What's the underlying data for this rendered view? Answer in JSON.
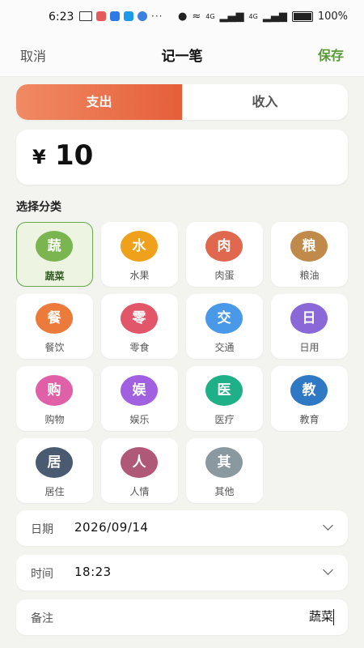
{
  "status": {
    "time": "6:23",
    "dots": "···",
    "network": "4G",
    "network2": "4G",
    "battery": "100%"
  },
  "nav": {
    "cancel": "取消",
    "title": "记一笔",
    "save": "保存"
  },
  "type_toggle": {
    "expense": "支出",
    "income": "收入",
    "selected": "支出"
  },
  "amount": {
    "currency": "¥",
    "value": "10"
  },
  "category_label": "选择分类",
  "categories": [
    {
      "char": "蔬",
      "name": "蔬菜",
      "color": "#7ab54f",
      "selected": true
    },
    {
      "char": "水",
      "name": "水果",
      "color": "#f0a11c"
    },
    {
      "char": "肉",
      "name": "肉蛋",
      "color": "#e0684e"
    },
    {
      "char": "粮",
      "name": "粮油",
      "color": "#c08a4a"
    },
    {
      "char": "餐",
      "name": "餐饮",
      "color": "#ec7a3a"
    },
    {
      "char": "零",
      "name": "零食",
      "color": "#e2566a"
    },
    {
      "char": "交",
      "name": "交通",
      "color": "#4a98e8"
    },
    {
      "char": "日",
      "name": "日用",
      "color": "#8a68d8"
    },
    {
      "char": "购",
      "name": "购物",
      "color": "#e060a8"
    },
    {
      "char": "娱",
      "name": "娱乐",
      "color": "#a060e0"
    },
    {
      "char": "医",
      "name": "医疗",
      "color": "#20b088"
    },
    {
      "char": "教",
      "name": "教育",
      "color": "#2f78c4"
    },
    {
      "char": "居",
      "name": "居住",
      "color": "#4a5a70"
    },
    {
      "char": "人",
      "name": "人情",
      "color": "#b05878"
    },
    {
      "char": "其",
      "name": "其他",
      "color": "#8a98a0"
    }
  ],
  "date": {
    "label": "日期",
    "value": "2026/09/14"
  },
  "time_field": {
    "label": "时间",
    "value": "18:23"
  },
  "note": {
    "label": "备注",
    "value": "蔬菜"
  }
}
